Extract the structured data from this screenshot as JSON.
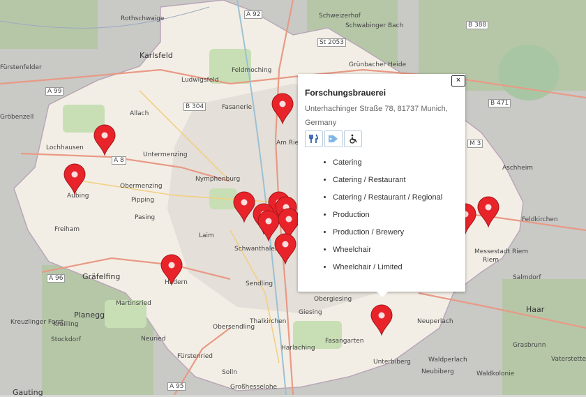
{
  "map": {
    "places": [
      {
        "name": "Karlsfeld"
      },
      {
        "name": "Rothschwaige"
      },
      {
        "name": "Ludwigsfeld"
      },
      {
        "name": "Feldmoching"
      },
      {
        "name": "Fasanerie"
      },
      {
        "name": "Allach"
      },
      {
        "name": "Untermenzing"
      },
      {
        "name": "Lochhausen"
      },
      {
        "name": "Gröbenzell"
      },
      {
        "name": "Aubing"
      },
      {
        "name": "Obermenzing"
      },
      {
        "name": "Pipping"
      },
      {
        "name": "Nymphenburg"
      },
      {
        "name": "Pasing"
      },
      {
        "name": "Laim"
      },
      {
        "name": "Freiham"
      },
      {
        "name": "Hadern"
      },
      {
        "name": "Gräfelfing"
      },
      {
        "name": "Martinsried"
      },
      {
        "name": "Planegg"
      },
      {
        "name": "Krailling"
      },
      {
        "name": "Stockdorf"
      },
      {
        "name": "Neuried"
      },
      {
        "name": "Fürstenried"
      },
      {
        "name": "Sendling"
      },
      {
        "name": "Obersendling"
      },
      {
        "name": "Thalkirchen"
      },
      {
        "name": "Solln"
      },
      {
        "name": "Großhesselohe"
      },
      {
        "name": "Harlaching"
      },
      {
        "name": "Giesing"
      },
      {
        "name": "Fasangarten"
      },
      {
        "name": "Unterbiberg"
      },
      {
        "name": "Neubiberg"
      },
      {
        "name": "Waldperlach"
      },
      {
        "name": "Neuperlach"
      },
      {
        "name": "Haar"
      },
      {
        "name": "Salmdorf"
      },
      {
        "name": "Riem"
      },
      {
        "name": "Messestadt Riem"
      },
      {
        "name": "Feldkirchen"
      },
      {
        "name": "Aschheim"
      },
      {
        "name": "Am Riesenfeld"
      },
      {
        "name": "Schwanthalerhöhe"
      },
      {
        "name": "Obergiesing"
      },
      {
        "name": "Gauting"
      },
      {
        "name": "Waldkolonie"
      },
      {
        "name": "Vaterstetten"
      },
      {
        "name": "Grasbrunn"
      },
      {
        "name": "Schweizerhof"
      },
      {
        "name": "Schwabinger Bach"
      },
      {
        "name": "Kreuzlinger Forst"
      },
      {
        "name": "Fürstenfelder"
      },
      {
        "name": "Grünbacher Heide"
      }
    ],
    "roads": [
      "A 92",
      "A 99",
      "B 304",
      "A 8",
      "A 96",
      "A 95",
      "St 2053",
      "B 388",
      "B 471",
      "M 3"
    ],
    "markers_count": 14
  },
  "popup": {
    "close_label": "×",
    "title": "Forschungsbrauerei",
    "address": "Unterhachinger Straße 78, 81737 Munich, Germany",
    "icons": [
      "fork-knife-icon",
      "price-tag-icon",
      "wheelchair-icon"
    ],
    "tags": [
      "Catering",
      "Catering / Restaurant",
      "Catering / Restaurant / Regional",
      "Production",
      "Production / Brewery",
      "Wheelchair",
      "Wheelchair / Limited"
    ]
  },
  "colors": {
    "marker": "#e8242a",
    "city": "#f3eee5",
    "residential": "#e0dcd6",
    "forest": "#aad09a",
    "water": "#aad3df"
  }
}
